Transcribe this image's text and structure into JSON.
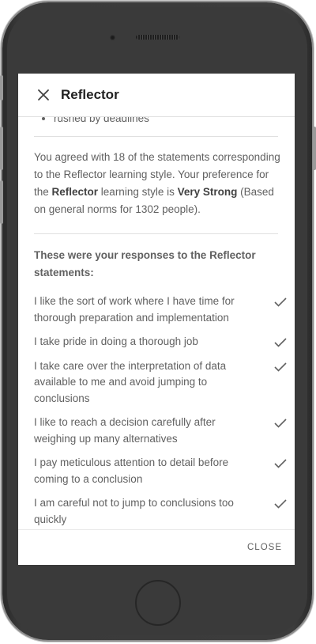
{
  "dialog": {
    "title": "Reflector",
    "close_label": "CLOSE"
  },
  "content": {
    "partial_bullet": "rushed by deadlines",
    "summary": {
      "part1": "You agreed with 18 of the statements corresponding to the Reflector learning style. Your preference for the ",
      "style_name": "Reflector",
      "part2": " learning style is ",
      "strength": "Very Strong",
      "part3": " (Based on general norms for 1302 people)."
    },
    "responses_heading": "These were your responses to the Reflector statements:",
    "responses": [
      "I like the sort of work where I have time for thorough preparation and implementation",
      "I take pride in doing a thorough job",
      "I take care over the interpretation of data available to me and avoid jumping to conclusions",
      "I like to reach a decision carefully after weighing up many alternatives",
      "I pay meticulous attention to detail before coming to a conclusion",
      "I am careful not to jump to conclusions too quickly"
    ]
  },
  "icons": {
    "close": "close-icon",
    "check": "check-icon"
  },
  "colors": {
    "text": "#616161",
    "title": "#212121",
    "divider": "#e0e0e0",
    "device": "#3a3a3a"
  }
}
